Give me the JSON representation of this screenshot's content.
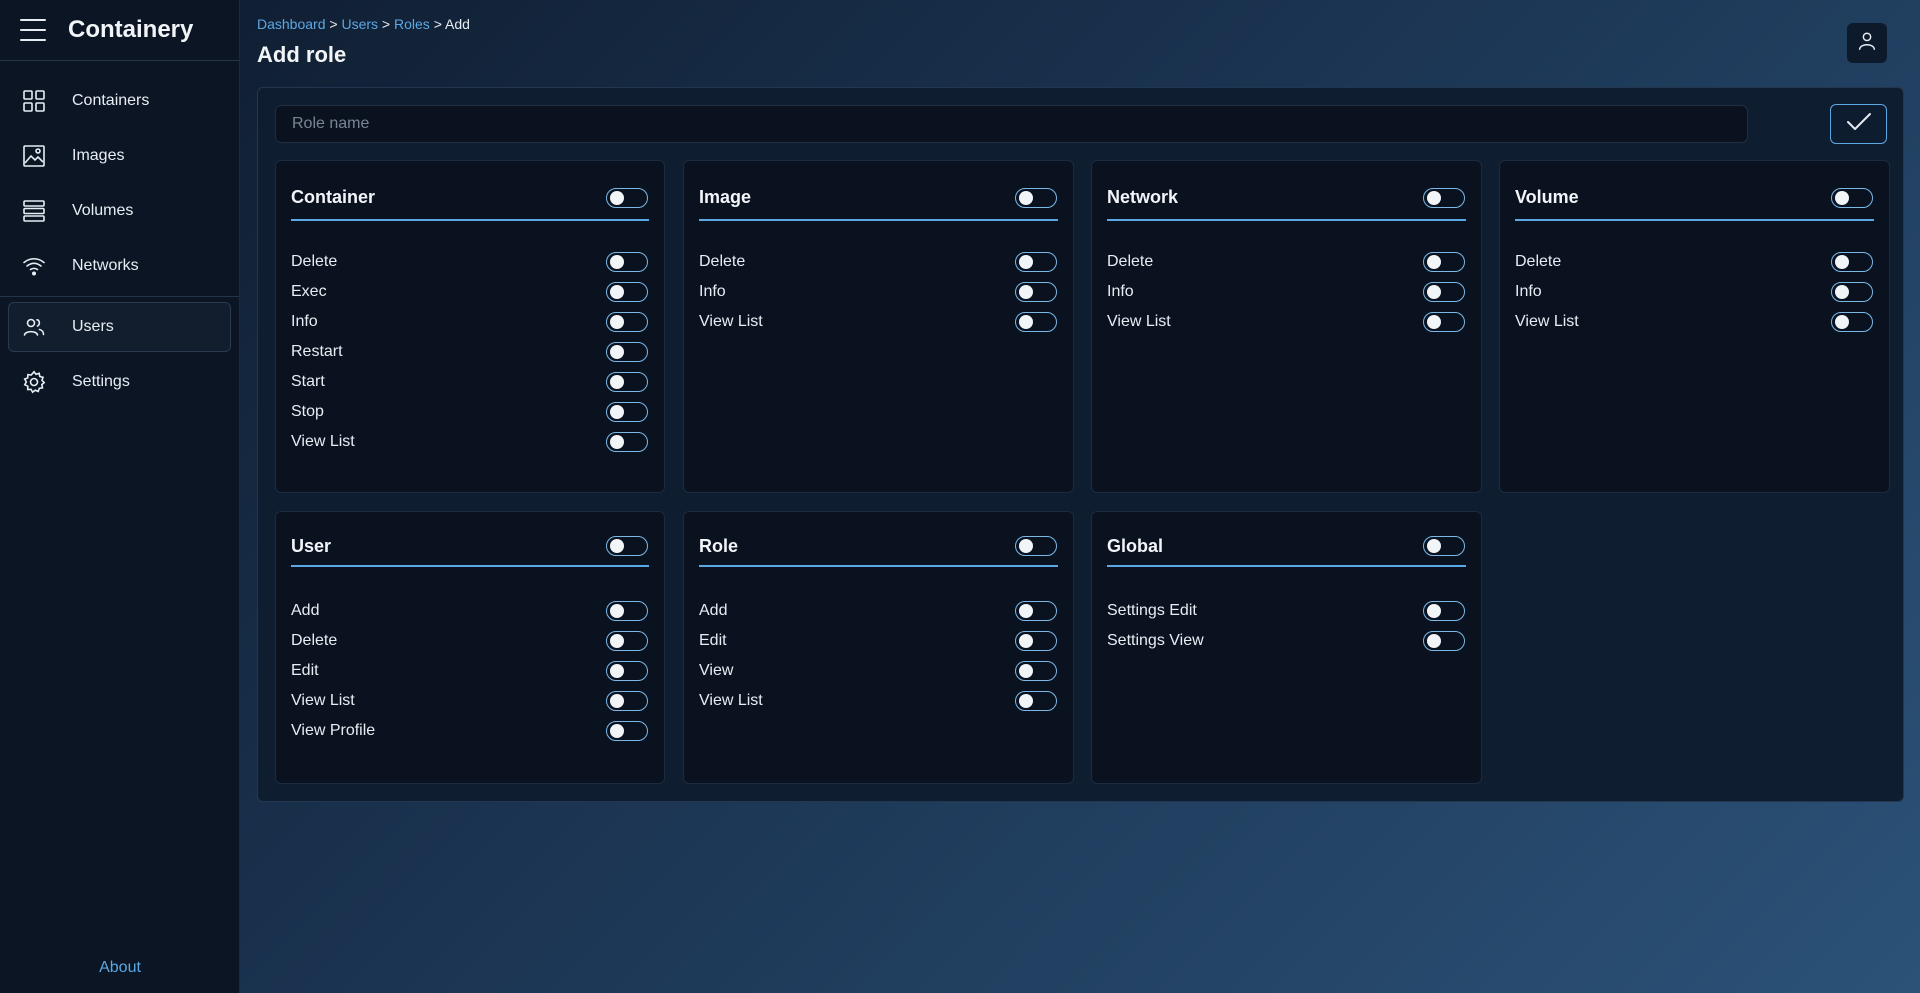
{
  "app": {
    "title": "Containery"
  },
  "sidebar": {
    "items": [
      {
        "label": "Containers",
        "icon": "grid-icon"
      },
      {
        "label": "Images",
        "icon": "image-icon"
      },
      {
        "label": "Volumes",
        "icon": "stack-icon"
      },
      {
        "label": "Networks",
        "icon": "wifi-icon"
      },
      {
        "label": "Users",
        "icon": "users-icon",
        "active": true
      },
      {
        "label": "Settings",
        "icon": "gear-icon"
      }
    ],
    "about": "About"
  },
  "breadcrumb": {
    "dashboard": "Dashboard",
    "users": "Users",
    "roles": "Roles",
    "current": "Add",
    "sep": ">"
  },
  "page": {
    "title": "Add role"
  },
  "form": {
    "role_name_placeholder": "Role name"
  },
  "colors": {
    "accent": "#5ba8e4",
    "card_bg": "#0a1220",
    "sidebar_bg": "#0b1524"
  },
  "groups": [
    {
      "title": "Container",
      "permissions": [
        "Delete",
        "Exec",
        "Info",
        "Restart",
        "Start",
        "Stop",
        "View List"
      ]
    },
    {
      "title": "Image",
      "permissions": [
        "Delete",
        "Info",
        "View List"
      ]
    },
    {
      "title": "Network",
      "permissions": [
        "Delete",
        "Info",
        "View List"
      ]
    },
    {
      "title": "Volume",
      "permissions": [
        "Delete",
        "Info",
        "View List"
      ]
    },
    {
      "title": "User",
      "permissions": [
        "Add",
        "Delete",
        "Edit",
        "View List",
        "View Profile"
      ]
    },
    {
      "title": "Role",
      "permissions": [
        "Add",
        "Edit",
        "View",
        "View List"
      ]
    },
    {
      "title": "Global",
      "permissions": [
        "Settings Edit",
        "Settings View"
      ]
    }
  ]
}
